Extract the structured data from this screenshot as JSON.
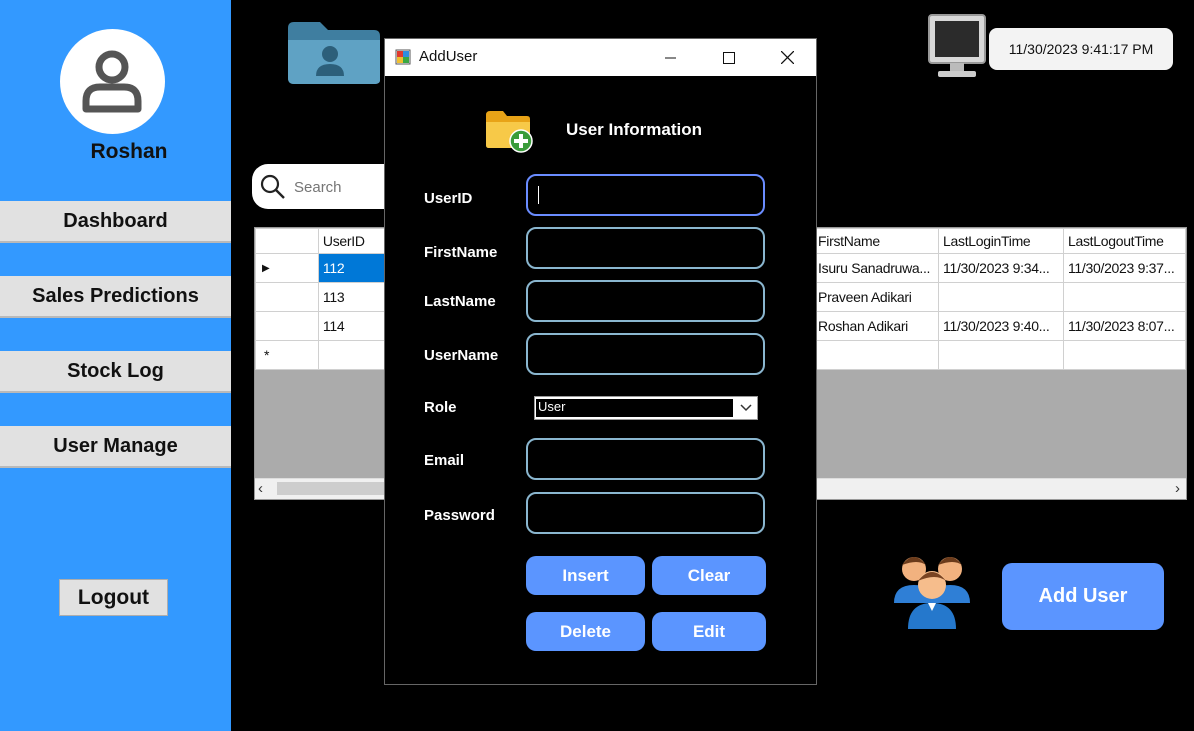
{
  "sidebar": {
    "username": "Roshan",
    "nav": [
      "Dashboard",
      "Sales Predictions",
      "Stock Log",
      "User Manage"
    ],
    "logout": "Logout"
  },
  "header": {
    "datetime": "11/30/2023 9:41:17 PM"
  },
  "search": {
    "placeholder": "Search"
  },
  "grid": {
    "columns": [
      "UserID",
      "FirstName",
      "LastLoginTime",
      "LastLogoutTime"
    ],
    "rows": [
      {
        "id": "112",
        "first": "Isuru Sanadruwa...",
        "login": "11/30/2023 9:34...",
        "logout": "11/30/2023 9:37..."
      },
      {
        "id": "113",
        "first": "Praveen  Adikari",
        "login": "",
        "logout": ""
      },
      {
        "id": "114",
        "first": "Roshan Adikari",
        "login": "11/30/2023 9:40...",
        "logout": "11/30/2023 8:07..."
      }
    ],
    "new_row_marker": "*",
    "current_row_marker": "▶"
  },
  "add_user_button": "Add User",
  "dialog": {
    "title": "AddUser",
    "section_title": "User Information",
    "labels": {
      "userid": "UserID",
      "firstname": "FirstName",
      "lastname": "LastName",
      "username": "UserName",
      "role": "Role",
      "email": "Email",
      "password": "Password"
    },
    "role_value": "User",
    "buttons": {
      "insert": "Insert",
      "clear": "Clear",
      "delete": "Delete",
      "edit": "Edit"
    }
  },
  "colors": {
    "sidebar": "#3399ff",
    "accent_button": "#5b95ff",
    "field_border": "#8ab6cf",
    "selected_row": "#0078d7"
  }
}
